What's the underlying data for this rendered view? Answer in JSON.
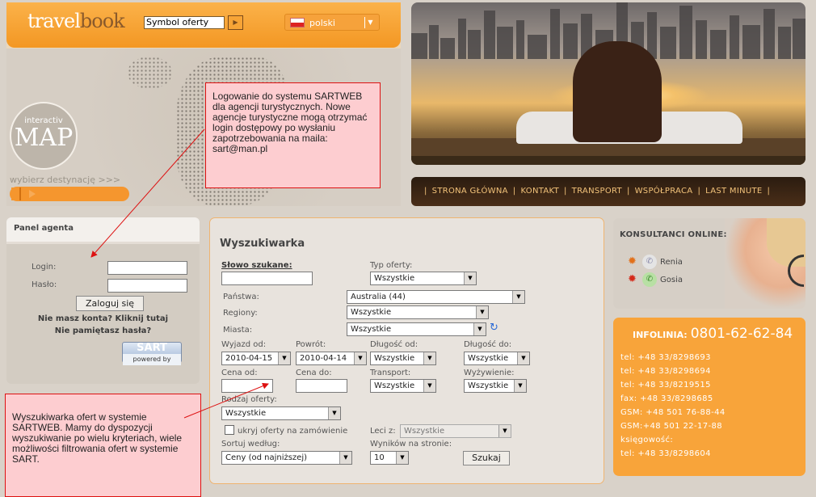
{
  "header": {
    "logo_left": "travel",
    "logo_right": "book",
    "symbol_input_value": "Symbol oferty",
    "go_icon": "play-arrow-icon",
    "language": "polski",
    "colors": {
      "orange": "#f5962e",
      "background": "#d9d2c9"
    }
  },
  "map": {
    "logo_small": "interactiv",
    "logo_big": "MAP",
    "destination_text": "wybierz destynację >>>"
  },
  "nav": {
    "items": [
      "STRONA GŁÓWNA",
      "KONTAKT",
      "TRANSPORT",
      "WSPÓŁPRACA",
      "LAST MINUTE"
    ],
    "separator": "|"
  },
  "panel_agenta": {
    "title": "Panel agenta",
    "login_label": "Login:",
    "password_label": "Hasło:",
    "login_button": "Zaloguj się",
    "no_account_link": "Nie masz konta? Kliknij tutaj",
    "forgot_link": "Nie pamiętasz hasła?",
    "sart_logo": "SART",
    "sart_powered": "powered by"
  },
  "search": {
    "title": "Wyszukiwarka",
    "keyword_label": "Słowo szukane:",
    "offer_type_label": "Typ oferty:",
    "offer_type_value": "Wszystkie",
    "countries_label": "Państwa:",
    "countries_value": "Australia (44)",
    "regions_label": "Regiony:",
    "regions_value": "Wszystkie",
    "cities_label": "Miasta:",
    "cities_value": "Wszystkie",
    "departure_label": "Wyjazd od:",
    "departure_value": "2010-04-15",
    "return_label": "Powrót:",
    "return_value": "2010-04-14",
    "length_from_label": "Długość od:",
    "length_from_value": "Wszystkie",
    "length_to_label": "Długość do:",
    "length_to_value": "Wszystkie",
    "price_from_label": "Cena od:",
    "price_to_label": "Cena do:",
    "transport_label": "Transport:",
    "transport_value": "Wszystkie",
    "board_label": "Wyżywienie:",
    "board_value": "Wszystkie",
    "offer_kind_label": "Rodzaj oferty:",
    "offer_kind_value": "Wszystkie",
    "hide_on_request_label": "ukryj oferty na zamówienie",
    "flights_from_label": "Leci z:",
    "flights_from_value": "Wszystkie",
    "sort_label": "Sortuj według:",
    "sort_value": "Ceny (od najniższej)",
    "per_page_label": "Wyników na stronie:",
    "per_page_value": "10",
    "search_button": "Szukaj"
  },
  "konsultanci": {
    "title": "KONSULTANCI ONLINE:",
    "people": [
      {
        "name": "Renia",
        "status": "offline"
      },
      {
        "name": "Gosia",
        "status": "online"
      }
    ]
  },
  "infolinia": {
    "label": "INFOLINIA:",
    "number": "0801-62-62-84",
    "lines": [
      "tel: +48 33/8298693",
      "tel: +48 33/8298694",
      "tel: +48 33/8219515",
      "fax: +48 33/8298685",
      "GSM: +48 501 76-88-44",
      "GSM:+48 501 22-17-88",
      "księgowość:",
      "tel: +48 33/8298604"
    ]
  },
  "annotations": {
    "login_note": "Logowanie do systemu SARTWEB dla agencji turystycznych. Nowe agencje turystyczne mogą otrzymać login dostępowy po wysłaniu zapotrzebowania na maila: sart@man.pl",
    "search_note": "Wyszukiwarka ofert w systemie SARTWEB. Mamy do dyspozycji wyszukiwanie po wielu kryteriach, wiele możliwości filtrowania ofert w systemie SART."
  }
}
